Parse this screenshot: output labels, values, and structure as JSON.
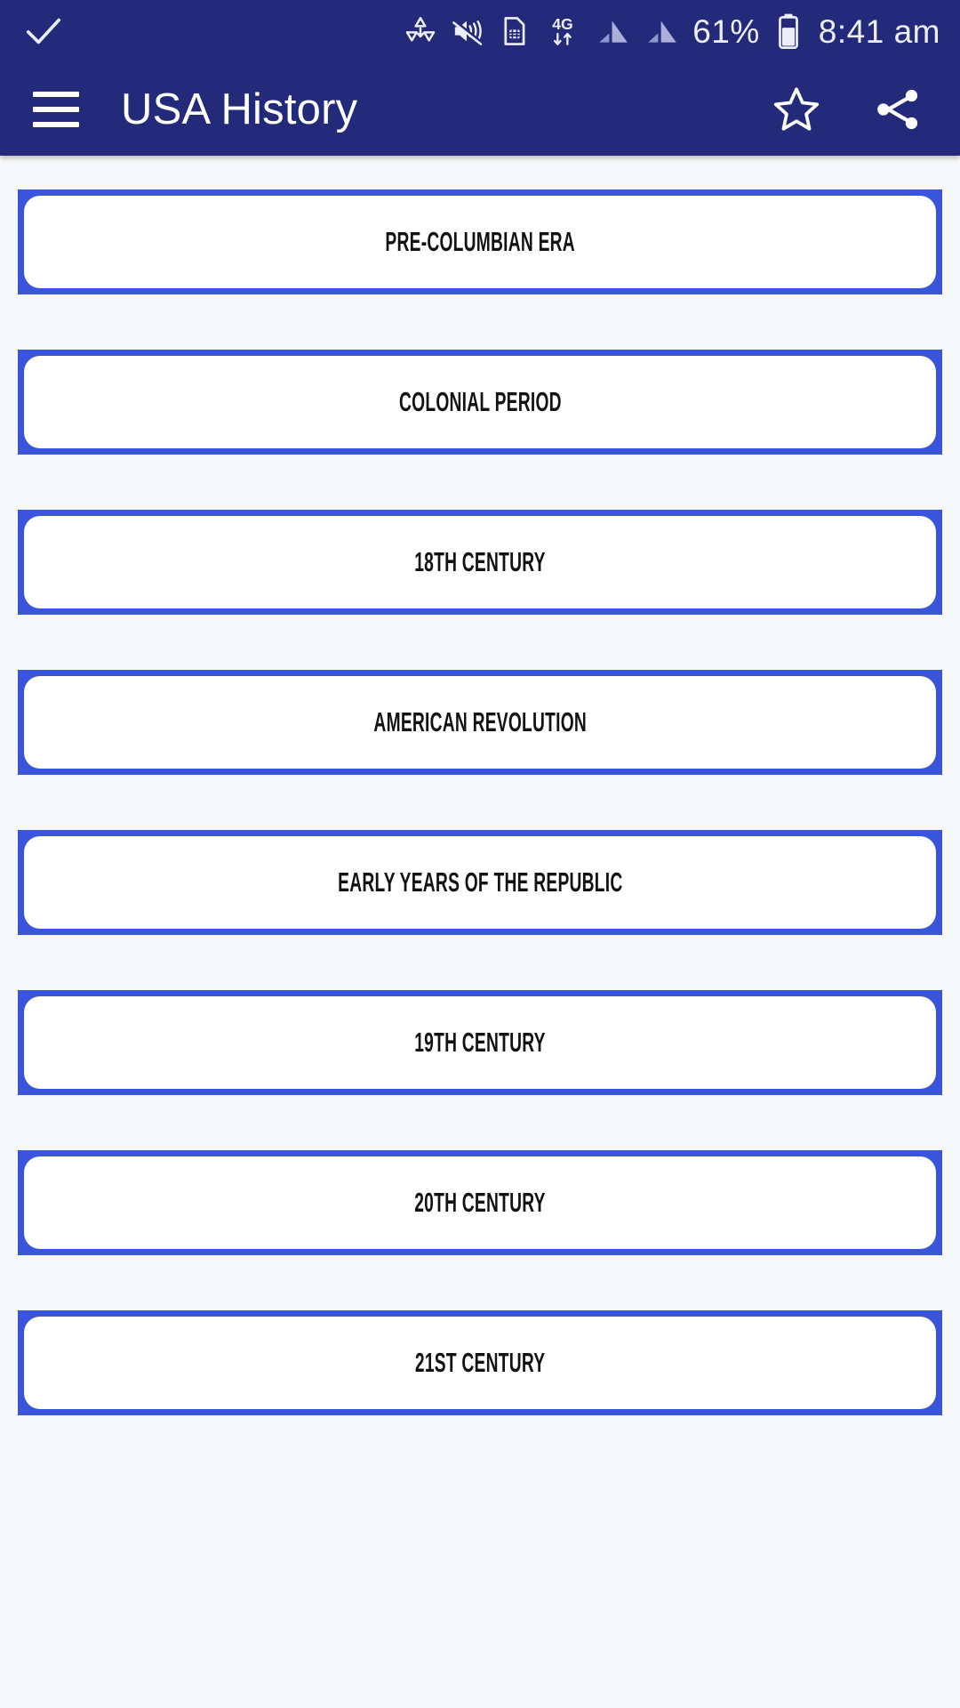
{
  "status_bar": {
    "left_icon": "checkmark-icon",
    "icons": [
      "data-saver-icon",
      "volume-mute-vibrate-icon",
      "sim-card-icon",
      "mobile-data-4g-icon",
      "signal-bars-1-icon",
      "signal-bars-2-icon"
    ],
    "network_type": "4G",
    "battery_percent": "61%",
    "battery_icon": "battery-icon",
    "time": "8:41 am"
  },
  "app_bar": {
    "menu_icon": "hamburger-menu-icon",
    "title": "USA History",
    "favorite_icon": "star-outline-icon",
    "share_icon": "share-icon",
    "background_color": "#232a7a"
  },
  "theme": {
    "primary": "#232a7a",
    "accent": "#3a55d9",
    "page_background": "#f7f8f9",
    "card_background": "#ffffff",
    "text_color": "#121212"
  },
  "list": {
    "items": [
      {
        "label": "PRE-COLUMBIAN ERA"
      },
      {
        "label": "COLONIAL PERIOD"
      },
      {
        "label": "18TH CENTURY"
      },
      {
        "label": "AMERICAN REVOLUTION"
      },
      {
        "label": "EARLY YEARS OF THE REPUBLIC"
      },
      {
        "label": "19TH CENTURY"
      },
      {
        "label": "20TH CENTURY"
      },
      {
        "label": "21ST CENTURY"
      }
    ]
  }
}
